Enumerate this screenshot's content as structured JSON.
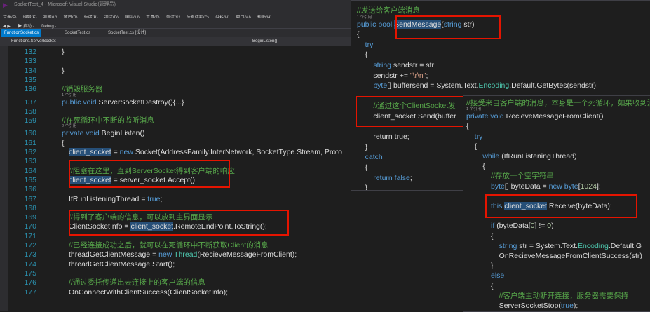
{
  "window": {
    "title": "SocketTest_4 - Microsoft Visual Studio(管理员)"
  },
  "menu": [
    "文件(F)",
    "编辑(E)",
    "视图(V)",
    "项目(P)",
    "生成(B)",
    "调试(D)",
    "团队(M)",
    "工具(T)",
    "测试(S)",
    "体系结构(C)",
    "分析(N)",
    "窗口(W)",
    "帮助(H)"
  ],
  "toolbar": {
    "start": "▶ 启动 ·",
    "config": "Debug ·"
  },
  "tabs": [
    "FunctionSocket.cs",
    "SocketTest.cs",
    "SocketTest.cs [设计]"
  ],
  "nav": {
    "left": "Functions.ServerSocket",
    "right": "BeginListen()"
  },
  "main_lines": [
    {
      "n": "132",
      "t": [
        [
          "}",
          ""
        ]
      ]
    },
    {
      "n": "133",
      "t": [
        [
          "",
          ""
        ]
      ]
    },
    {
      "n": "134",
      "t": [
        [
          "}",
          ""
        ]
      ]
    },
    {
      "n": "135",
      "t": [
        [
          "",
          ""
        ]
      ]
    },
    {
      "n": "136",
      "t": [
        [
          "//销毁服务器",
          "c"
        ]
      ]
    },
    {
      "n": "",
      "ref": "1 个引用"
    },
    {
      "n": "137",
      "t": [
        [
          "public void ",
          "k"
        ],
        [
          "ServerSocketDestroy(){...}",
          ""
        ]
      ]
    },
    {
      "n": "158",
      "t": [
        [
          "",
          ""
        ]
      ]
    },
    {
      "n": "159",
      "t": [
        [
          "//在死循环中不断的监听消息",
          "c"
        ]
      ]
    },
    {
      "n": "",
      "ref": "2 个引用"
    },
    {
      "n": "160",
      "t": [
        [
          "private void ",
          "k"
        ],
        [
          "BeginListen()",
          ""
        ]
      ]
    },
    {
      "n": "161",
      "t": [
        [
          "{",
          ""
        ]
      ]
    },
    {
      "n": "162",
      "t": [
        [
          "client_socket",
          "hl"
        ],
        [
          " = ",
          ""
        ],
        [
          "new ",
          "k"
        ],
        [
          "Socket",
          ""
        ],
        [
          "(AddressFamily.InterNetwork, SocketType.Stream, Proto",
          ""
        ]
      ]
    },
    {
      "n": "163",
      "t": [
        [
          "",
          ""
        ]
      ]
    },
    {
      "n": "164",
      "t": [
        [
          "//阻塞在这里，直到ServerSocket得到客户端的响应",
          "c"
        ]
      ]
    },
    {
      "n": "165",
      "t": [
        [
          "client_socket",
          "hl"
        ],
        [
          " = server_socket.Accept();",
          ""
        ]
      ]
    },
    {
      "n": "166",
      "t": [
        [
          "",
          ""
        ]
      ]
    },
    {
      "n": "167",
      "t": [
        [
          "IfRunListeningThread = ",
          ""
        ],
        [
          "true",
          "k"
        ],
        [
          ";",
          ""
        ]
      ]
    },
    {
      "n": "168",
      "t": [
        [
          "",
          ""
        ]
      ]
    },
    {
      "n": "169",
      "t": [
        [
          "//得到了客户端的信息，可以放到主界面显示",
          "c"
        ]
      ]
    },
    {
      "n": "170",
      "t": [
        [
          "ClientSocketInfo = ",
          ""
        ],
        [
          "client_socket",
          "hl"
        ],
        [
          ".RemoteEndPoint.ToString();",
          ""
        ]
      ]
    },
    {
      "n": "171",
      "t": [
        [
          "",
          ""
        ]
      ]
    },
    {
      "n": "172",
      "t": [
        [
          "//已经连接成功之后，就可以在死循环中不断获取Client的消息",
          "c"
        ]
      ]
    },
    {
      "n": "173",
      "t": [
        [
          "threadGetClientMessage = ",
          ""
        ],
        [
          "new ",
          "k"
        ],
        [
          "Thread",
          "ty"
        ],
        [
          "(RecieveMessageFromClient);",
          ""
        ]
      ]
    },
    {
      "n": "174",
      "t": [
        [
          "threadGetClientMessage.Start();",
          ""
        ]
      ]
    },
    {
      "n": "175",
      "t": [
        [
          "",
          ""
        ]
      ]
    },
    {
      "n": "176",
      "t": [
        [
          "//通过委托传递出去连接上的客户端的信息",
          "c"
        ]
      ]
    },
    {
      "n": "177",
      "t": [
        [
          "OnConnectWithClientSuccess(ClientSocketInfo);",
          ""
        ]
      ]
    }
  ],
  "popup1_lines": [
    {
      "t": [
        [
          "//发送给客户端消息",
          "c"
        ]
      ]
    },
    {
      "ref": "1 个引用"
    },
    {
      "t": [
        [
          "public bool ",
          "k"
        ],
        [
          "SendMessage",
          "hl"
        ],
        [
          "(",
          ""
        ],
        [
          "string ",
          "k"
        ],
        [
          "str)",
          ""
        ]
      ]
    },
    {
      "t": [
        [
          "{",
          ""
        ]
      ]
    },
    {
      "t": [
        [
          "    try",
          "k"
        ]
      ]
    },
    {
      "t": [
        [
          "    {",
          ""
        ]
      ]
    },
    {
      "t": [
        [
          "        string ",
          "k"
        ],
        [
          "sendstr = str;",
          ""
        ]
      ]
    },
    {
      "t": [
        [
          "        sendstr += ",
          ""
        ],
        [
          "\"\\r\\n\"",
          "s"
        ],
        [
          ";",
          ""
        ]
      ]
    },
    {
      "t": [
        [
          "        byte",
          "k"
        ],
        [
          "[] buffersend = System.Text.",
          ""
        ],
        [
          "Encoding",
          "ty"
        ],
        [
          ".Default.GetBytes(sendstr);",
          ""
        ]
      ]
    },
    {
      "t": [
        [
          "",
          ""
        ]
      ]
    },
    {
      "t": [
        [
          "        //通过这个ClientSocket发",
          "c"
        ]
      ]
    },
    {
      "t": [
        [
          "        client_socket.Send(buffer",
          ""
        ]
      ]
    },
    {
      "t": [
        [
          "",
          ""
        ]
      ]
    },
    {
      "t": [
        [
          "        return true",
          ""
        ],
        [
          ";",
          ""
        ]
      ]
    },
    {
      "t": [
        [
          "    }",
          ""
        ]
      ]
    },
    {
      "t": [
        [
          "    catch",
          "k"
        ]
      ]
    },
    {
      "t": [
        [
          "    {",
          ""
        ]
      ]
    },
    {
      "t": [
        [
          "        return false",
          "k"
        ],
        [
          ";",
          ""
        ]
      ]
    },
    {
      "t": [
        [
          "    }",
          ""
        ]
      ]
    }
  ],
  "popup2_lines": [
    {
      "t": [
        [
          "//接受来自客户端的消息，本身是一个死循环，如果收到消息",
          "c"
        ]
      ]
    },
    {
      "ref": "1 个引用"
    },
    {
      "t": [
        [
          "private void ",
          "k"
        ],
        [
          "RecieveMessageFromClient()",
          ""
        ]
      ]
    },
    {
      "t": [
        [
          "{",
          ""
        ]
      ]
    },
    {
      "t": [
        [
          "    try",
          "k"
        ]
      ]
    },
    {
      "t": [
        [
          "    {",
          ""
        ]
      ]
    },
    {
      "t": [
        [
          "        while ",
          "k"
        ],
        [
          "(IfRunListeningThread)",
          ""
        ]
      ]
    },
    {
      "t": [
        [
          "        {",
          ""
        ]
      ]
    },
    {
      "t": [
        [
          "            //存放一个空字符串",
          "c"
        ]
      ]
    },
    {
      "t": [
        [
          "            byte",
          "k"
        ],
        [
          "[] byteData = ",
          ""
        ],
        [
          "new ",
          "k"
        ],
        [
          "byte",
          "k"
        ],
        [
          "[",
          ""
        ],
        [
          "1024",
          "n"
        ],
        [
          "];",
          ""
        ]
      ]
    },
    {
      "t": [
        [
          "",
          ""
        ]
      ]
    },
    {
      "t": [
        [
          "            this",
          "k"
        ],
        [
          ".",
          ""
        ],
        [
          "client_socket",
          "hl"
        ],
        [
          ".Receive(byteData);",
          ""
        ]
      ]
    },
    {
      "t": [
        [
          "",
          ""
        ]
      ]
    },
    {
      "t": [
        [
          "            if ",
          "k"
        ],
        [
          "(byteData[",
          ""
        ],
        [
          "0",
          "n"
        ],
        [
          "] != ",
          ""
        ],
        [
          "0",
          "n"
        ],
        [
          ")",
          ""
        ]
      ]
    },
    {
      "t": [
        [
          "            {",
          ""
        ]
      ]
    },
    {
      "t": [
        [
          "                string ",
          "k"
        ],
        [
          "str = System.Text.",
          ""
        ],
        [
          "Encoding",
          "ty"
        ],
        [
          ".Default.G",
          ""
        ]
      ]
    },
    {
      "t": [
        [
          "                OnRecieveMessageFromClientSuccess(str)",
          ""
        ]
      ]
    },
    {
      "t": [
        [
          "            }",
          ""
        ]
      ]
    },
    {
      "t": [
        [
          "            else",
          "k"
        ]
      ]
    },
    {
      "t": [
        [
          "            {",
          ""
        ]
      ]
    },
    {
      "t": [
        [
          "                //客户端主动断开连接，服务器需要保持",
          "c"
        ]
      ]
    },
    {
      "t": [
        [
          "                ServerSocketStop(",
          ""
        ],
        [
          "true",
          "k"
        ],
        [
          ");",
          ""
        ]
      ]
    }
  ]
}
